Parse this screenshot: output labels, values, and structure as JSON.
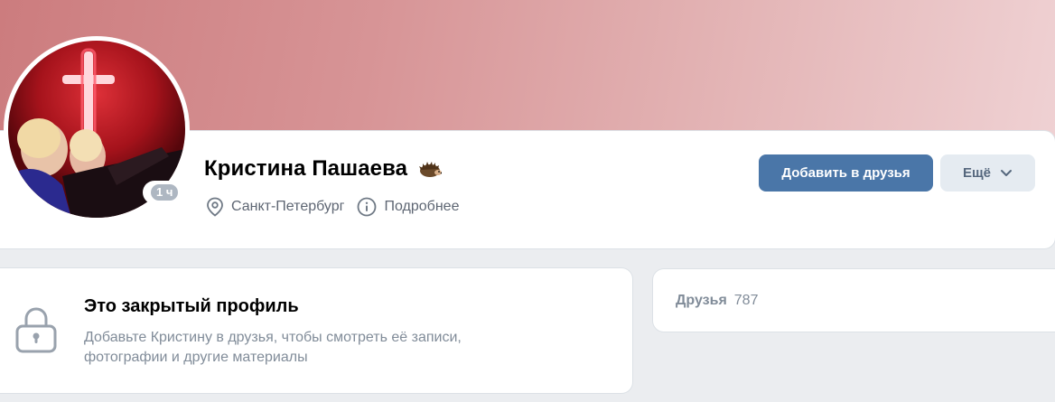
{
  "profile": {
    "name": "Кристина Пашаева",
    "emoji_icon": "hedgehog-emoji",
    "online_status": "1 ч",
    "city": "Санкт-Петербург",
    "details_label": "Подробнее"
  },
  "actions": {
    "add_friend_label": "Добавить в друзья",
    "more_label": "Ещё"
  },
  "closed_profile": {
    "title": "Это закрытый профиль",
    "description": "Добавьте Кристину в друзья, чтобы смотреть её записи, фотографии и другие материалы"
  },
  "friends": {
    "label": "Друзья",
    "count": "787"
  },
  "colors": {
    "primary_button": "#4a76a8",
    "secondary_button": "#e5ebf1",
    "muted_text": "#818c99",
    "page_background": "#ebedf0"
  }
}
